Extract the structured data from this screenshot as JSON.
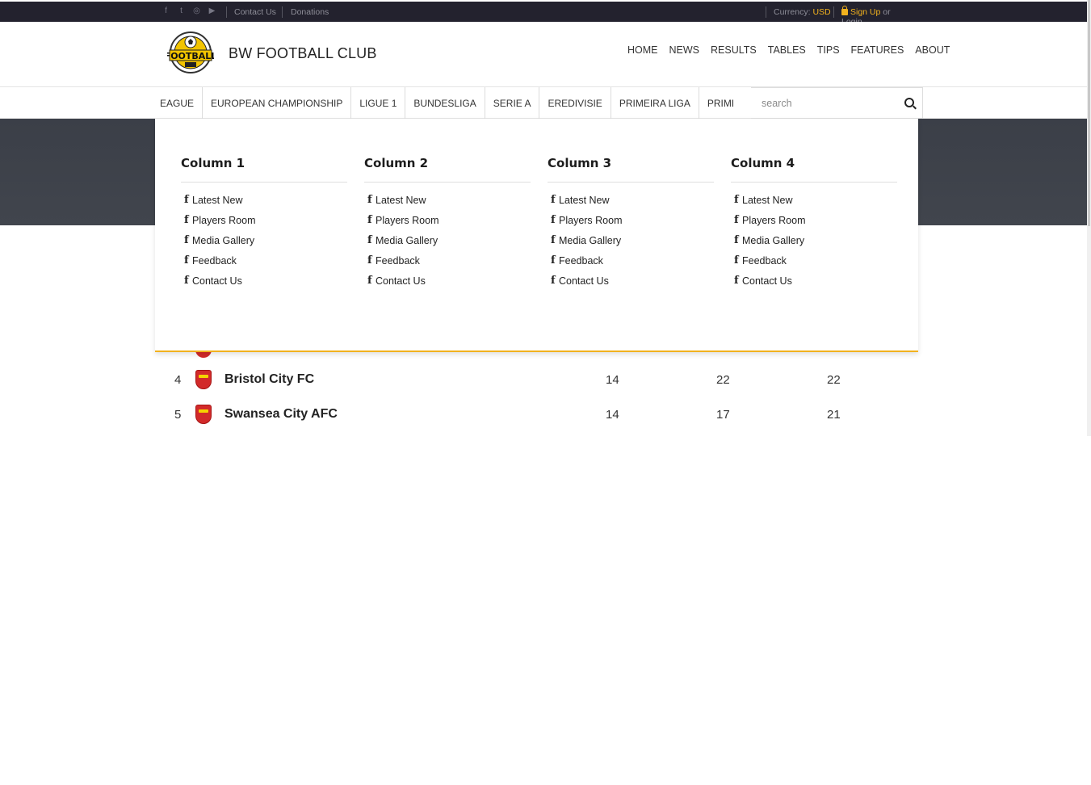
{
  "topbar": {
    "social_icons": [
      "facebook-icon",
      "twitter-icon",
      "instagram-icon",
      "youtube-icon"
    ],
    "links": [
      "Contact Us",
      "Donations"
    ],
    "currency_label": "Currency:",
    "currency_value": "USD",
    "signup": "Sign Up",
    "or": "or",
    "login": "Login"
  },
  "header": {
    "brand": "BW FOOTBALL CLUB",
    "nav": [
      "HOME",
      "NEWS",
      "RESULTS",
      "TABLES",
      "TIPS",
      "FEATURES",
      "ABOUT"
    ]
  },
  "leagues": [
    "EAGUE",
    "EUROPEAN CHAMPIONSHIP",
    "LIGUE 1",
    "BUNDESLIGA",
    "SERIE A",
    "EREDIVISIE",
    "PRIMEIRA LIGA",
    "PRIMERA DIVISION"
  ],
  "search": {
    "placeholder": "search"
  },
  "mega_menu": {
    "columns": [
      {
        "title": "Column 1",
        "items": [
          "Latest New",
          "Players Room",
          "Media Gallery",
          "Feedback",
          "Contact Us"
        ]
      },
      {
        "title": "Column 2",
        "items": [
          "Latest New",
          "Players Room",
          "Media Gallery",
          "Feedback",
          "Contact Us"
        ]
      },
      {
        "title": "Column 3",
        "items": [
          "Latest New",
          "Players Room",
          "Media Gallery",
          "Feedback",
          "Contact Us"
        ]
      },
      {
        "title": "Column 4",
        "items": [
          "Latest New",
          "Players Room",
          "Media Gallery",
          "Feedback",
          "Contact Us"
        ]
      }
    ]
  },
  "table": {
    "rows": [
      {
        "pos": "4",
        "team": "Bristol City FC",
        "c1": "14",
        "c2": "22",
        "c3": "22"
      },
      {
        "pos": "5",
        "team": "Swansea City AFC",
        "c1": "14",
        "c2": "17",
        "c3": "21"
      }
    ]
  },
  "colors": {
    "accent": "#f2b21e",
    "topbar": "#23222e",
    "hero": "#3e424b"
  }
}
